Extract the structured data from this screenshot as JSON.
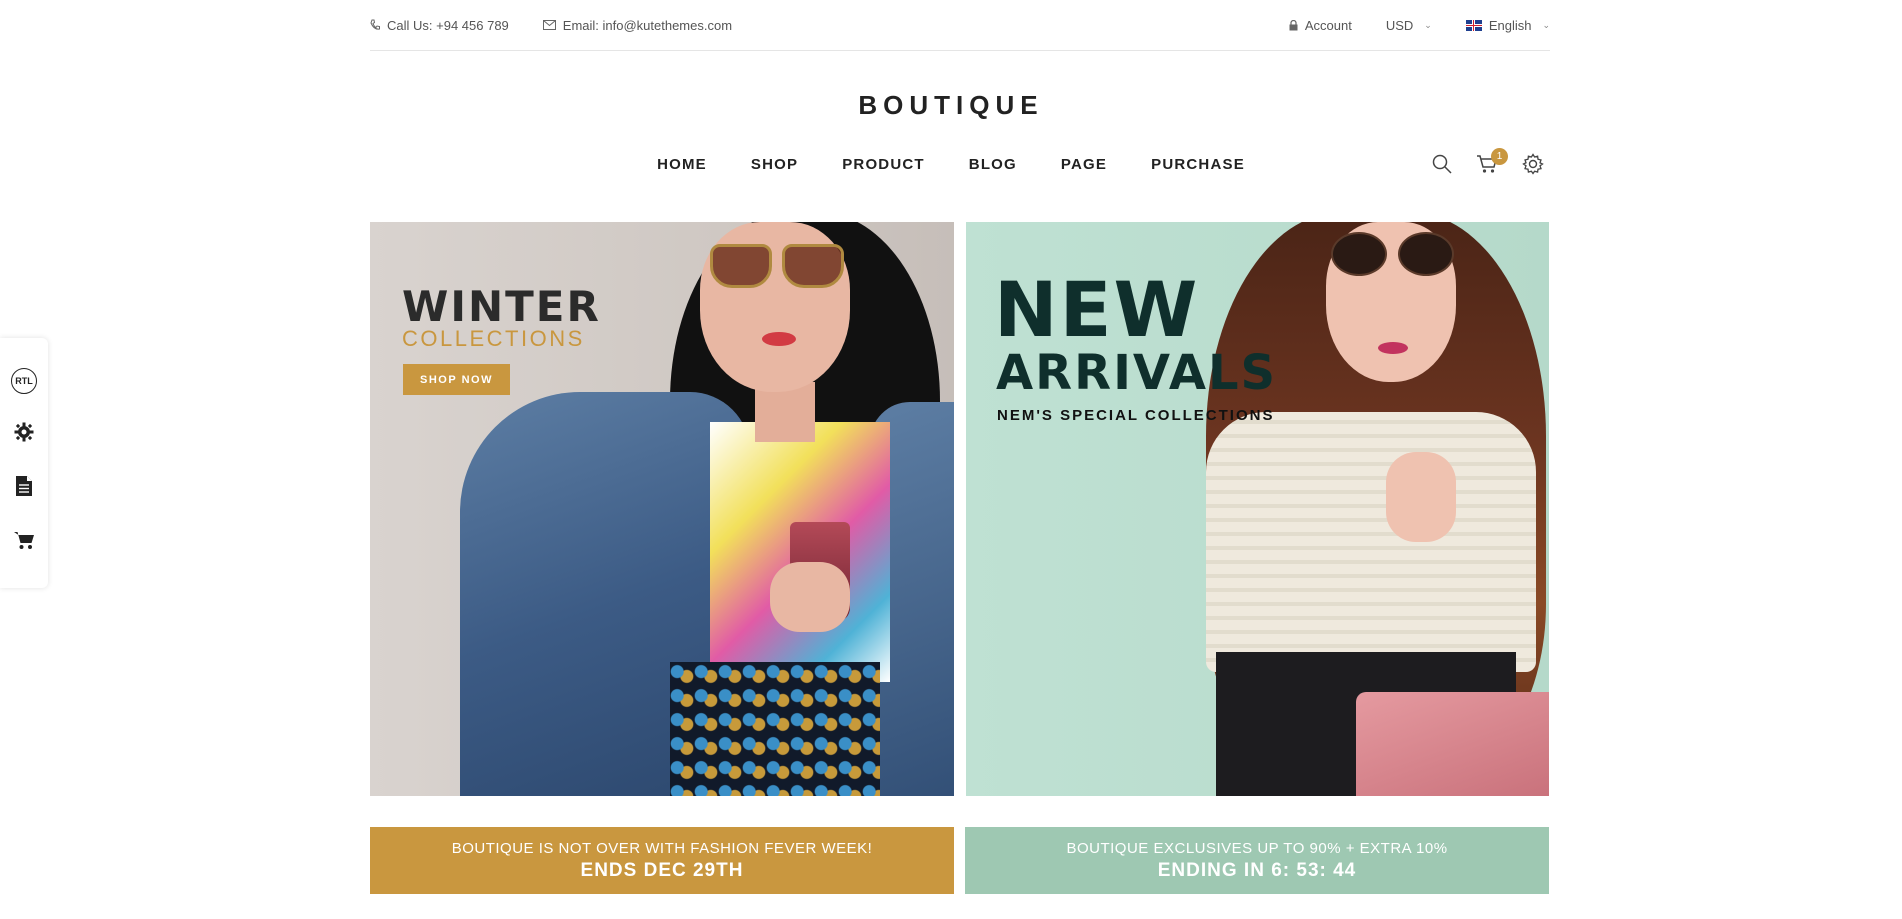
{
  "topbar": {
    "phone": "Call Us: +94 456 789",
    "email": "Email: info@kutethemes.com",
    "account": "Account",
    "currency": "USD",
    "language": "English"
  },
  "header": {
    "logo": "BOUTIQUE",
    "nav": [
      "HOME",
      "SHOP",
      "PRODUCT",
      "BLOG",
      "PAGE",
      "PURCHASE"
    ],
    "cart_count": "1"
  },
  "sidebar": {
    "rtl_label": "RTL",
    "icons": [
      "rtl-icon",
      "gear-icon",
      "document-icon",
      "cart-icon"
    ]
  },
  "banner_left": {
    "title": "WINTER",
    "subtitle": "COLLECTIONS",
    "button": "SHOP NOW"
  },
  "banner_right": {
    "title_line1": "NEW",
    "title_line2": "ARRIVALS",
    "subtitle": "NEM'S SPECIAL COLLECTIONS"
  },
  "promo_left": {
    "line1": "BOUTIQUE IS NOT OVER WITH FASHION FEVER WEEK!",
    "line2": "ENDS DEC 29TH"
  },
  "promo_right": {
    "line1": "BOUTIQUE EXCLUSIVES UP TO 90% + EXTRA 10%",
    "line2": "ENDING IN 6: 53: 44"
  },
  "colors": {
    "accent_gold": "#c9973f",
    "accent_mint": "#9ec8b2",
    "text_dark": "#222222"
  }
}
